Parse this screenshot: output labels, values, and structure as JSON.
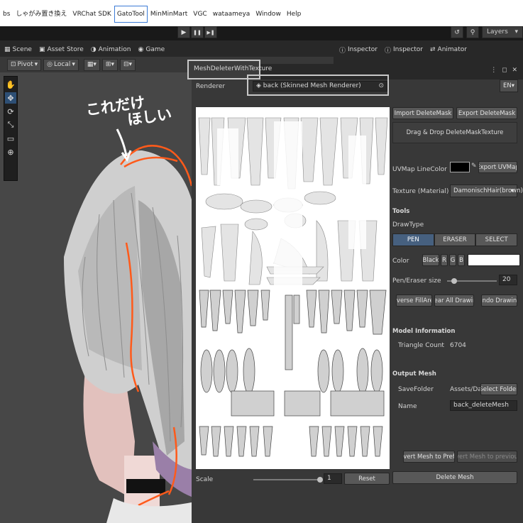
{
  "menubar": {
    "items": [
      "bs",
      "しゃがみ置き換え",
      "VRChat SDK",
      "GatoTool",
      "MinMinMart",
      "VGC",
      "wataameya",
      "Window",
      "Help"
    ],
    "selected": "GatoTool"
  },
  "toolbar": {
    "play_icon": "▶",
    "pause_icon": "❚❚",
    "step_icon": "▶❚",
    "history_icon": "↺",
    "search_icon": "⚲",
    "layers_label": "Layers"
  },
  "scene_tabs": {
    "scene": "Scene",
    "asset_store": "Asset Store",
    "animation": "Animation",
    "game": "Game"
  },
  "scene_tools": {
    "pivot": "Pivot",
    "local": "Local"
  },
  "annotation": {
    "line1": "これだけ",
    "line2": "ほしい"
  },
  "right_tabs": {
    "inspector1": "Inspector",
    "inspector2": "Inspector",
    "animator": "Animator"
  },
  "window": {
    "title": "MeshDeleterWithTexture",
    "controls": "⋮ ◻ ✕",
    "renderer_label": "Renderer",
    "renderer_value": "back (Skinned Mesh Renderer)",
    "language": "EN",
    "import_btn": "Import DeleteMask",
    "export_btn": "Export DeleteMask",
    "dragdrop_label": "Drag & Drop DeleteMaskTexture",
    "uvmap_linecolor_label": "UVMap LineColor",
    "export_uvmap_btn": "Export UVMap",
    "texture_label": "Texture (Material)",
    "texture_value": "DamonischHair(brown)",
    "tools_header": "Tools",
    "drawtype_label": "DrawType",
    "drawtypes": [
      "PEN",
      "ERASER",
      "SELECT"
    ],
    "drawtype_selected": "PEN",
    "color_label": "Color",
    "color_buttons": [
      "Black",
      "R",
      "G",
      "B"
    ],
    "pen_size_label": "Pen/Eraser size",
    "pen_size_value": "20",
    "inverse_btn": "Inverse FillArea",
    "clear_btn": "Clear All Drawing",
    "undo_btn": "Undo Drawing",
    "model_info_header": "Model Information",
    "triangle_label": "Triangle Count",
    "triangle_value": "6704",
    "output_header": "Output Mesh",
    "savefolder_label": "SaveFolder",
    "savefolder_value": "Assets/Damo",
    "select_folder_btn": "Select Folder",
    "name_label": "Name",
    "name_value": "back_deleteMesh",
    "revert_prefab_btn": "Revert Mesh to Prefab",
    "revert_prev_btn": "Revert Mesh to previously",
    "scale_label": "Scale",
    "scale_value": "1",
    "reset_btn": "Reset",
    "delete_btn": "Delete Mesh"
  },
  "colors": {
    "accent_blue": "#46607f",
    "highlight_orange": "#ff5a1a",
    "panel": "#383838"
  }
}
